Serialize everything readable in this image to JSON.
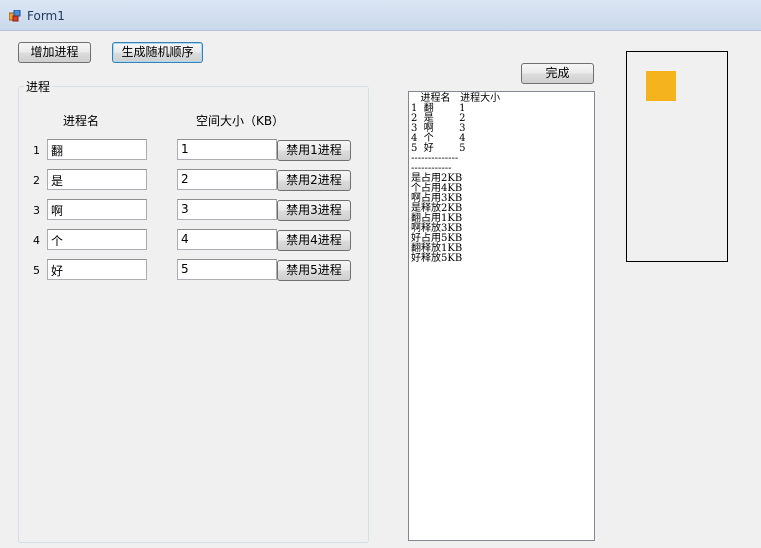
{
  "window": {
    "title": "Form1",
    "icon": "form-icon"
  },
  "toolbar": {
    "add_process_label": "增加进程",
    "random_order_label": "生成随机顺序"
  },
  "done_label": "完成",
  "group": {
    "legend": "进程",
    "col_name": "进程名",
    "col_size": "空间大小（KB）",
    "rows": [
      {
        "num": "1",
        "name": "翻",
        "size": "1",
        "disable_label": "禁用1进程"
      },
      {
        "num": "2",
        "name": "是",
        "size": "2",
        "disable_label": "禁用2进程"
      },
      {
        "num": "3",
        "name": "啊",
        "size": "3",
        "disable_label": "禁用3进程"
      },
      {
        "num": "4",
        "name": "个",
        "size": "4",
        "disable_label": "禁用4进程"
      },
      {
        "num": "5",
        "name": "好",
        "size": "5",
        "disable_label": "禁用5进程"
      }
    ]
  },
  "output_lines": [
    "   进程名   进程大小",
    "1  翻        1",
    "2  是        2",
    "3  啊        3",
    "4  个        4",
    "5  好        5",
    "--------------",
    "------------",
    "是占用2KB",
    "个占用4KB",
    "啊占用3KB",
    "是释放2KB",
    "翻占用1KB",
    "啊释放3KB",
    "好占用5KB",
    "翻释放1KB",
    "好释放5KB"
  ],
  "colors": {
    "accent_block": "#f5b41e",
    "titlebar_text": "#1e395b"
  }
}
